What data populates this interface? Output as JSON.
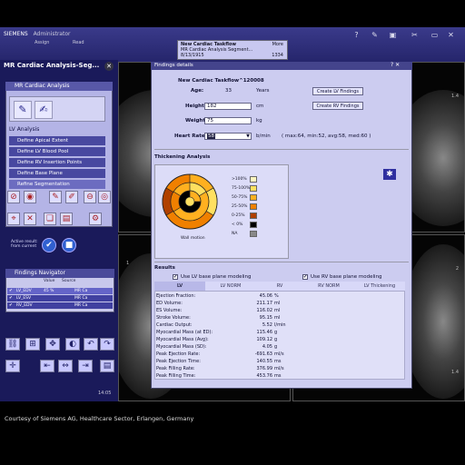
{
  "topbar": {
    "brand": "SIEMENS",
    "user": "Administrator",
    "nav": [
      "Assign",
      "Read"
    ],
    "taskflow": {
      "line1": "New Cardiac Taskflow",
      "line2": "MR Cardiac Analysis Segment...",
      "line3": "8/13/1915",
      "right1": "More",
      "right3": "1334"
    },
    "icons": [
      "help-icon",
      "edit-icon",
      "window-icon",
      "cancel-icon",
      "tools-icon",
      "folder-icon",
      "monitor-icon",
      "close-icon"
    ],
    "glyphs": [
      "?",
      "✎",
      "▣",
      "⊘",
      "✂",
      "▭",
      "▦",
      "✕"
    ]
  },
  "left": {
    "title": "MR Cardiac Analysis-Seg...",
    "sub_title": "MR Cardiac Analysis",
    "section": "LV Analysis",
    "steps": [
      "Define Apical Extent",
      "Define LV Blood Pool",
      "Define RV Insertion Points",
      "Define Base Plane",
      "Refine Segmentation"
    ],
    "active_result": "Active result: from current",
    "findings_title": "Findings Navigator",
    "findings_cols": [
      "Value",
      "Source"
    ],
    "findings": [
      {
        "name": "LV_EDV",
        "value": "45 %",
        "source": "MR Ca"
      },
      {
        "name": "LV_ESV",
        "value": "",
        "source": "MR Ca"
      },
      {
        "name": "RV_EDV",
        "value": "",
        "source": "MR Ca"
      }
    ],
    "time": "14:05"
  },
  "viewports": {
    "num_tr": "1.4",
    "num_ml": "1",
    "num_mr": "2",
    "num_br": "1.4"
  },
  "dialog": {
    "title": "Findings details",
    "controls": "? ✕",
    "taskflow": "New Cardiac Taskflow^120008",
    "age_label": "Age:",
    "age_value": "33",
    "age_unit": "Years",
    "height_label": "Height:",
    "height_value": "182",
    "height_unit": "cm",
    "weight_label": "Weight:",
    "weight_value": "75",
    "weight_unit": "kg",
    "hr_label": "Heart Rate:",
    "hr_value": "58",
    "hr_unit": "b/min",
    "hr_stats": "( max:64, min:52, avg:58, med:60 )",
    "btn_lv": "Create LV Findings",
    "btn_rv": "Create RV Findings",
    "thick_title": "Thickening Analysis",
    "wall_motion": "Wall motion",
    "legend": [
      {
        "label": ">100%",
        "color": "#fff7c0"
      },
      {
        "label": "75-100%",
        "color": "#ffe060"
      },
      {
        "label": "50-75%",
        "color": "#ffb020"
      },
      {
        "label": "25-50%",
        "color": "#f08000"
      },
      {
        "label": "0-25%",
        "color": "#b04000"
      },
      {
        "label": "< 0%",
        "color": "#000000"
      },
      {
        "label": "NA",
        "color": "#888888"
      }
    ],
    "results_title": "Results",
    "lv_check": "Use LV base plane modeling",
    "rv_check": "Use RV base plane modeling",
    "tabs": [
      "LV",
      "LV NORM",
      "RV",
      "RV NORM",
      "LV Thickening"
    ],
    "results": [
      {
        "name": "Ejection Fraction:",
        "value": "45.06",
        "unit": "%"
      },
      {
        "name": "ED Volume:",
        "value": "211.17",
        "unit": "ml"
      },
      {
        "name": "ES Volume:",
        "value": "116.02",
        "unit": "ml"
      },
      {
        "name": "Stroke Volume:",
        "value": "95.15",
        "unit": "ml"
      },
      {
        "name": "Cardiac Output:",
        "value": "5.52",
        "unit": "l/min"
      },
      {
        "name": "Myocardial Mass (at ED):",
        "value": "115.46",
        "unit": "g"
      },
      {
        "name": "Myocardial Mass (Avg):",
        "value": "109.12",
        "unit": "g"
      },
      {
        "name": "Myocardial Mass (SD):",
        "value": "4.05",
        "unit": "g"
      },
      {
        "name": "Peak Ejection Rate:",
        "value": "-691.63",
        "unit": "ml/s"
      },
      {
        "name": "Peak Ejection Time:",
        "value": "140.55",
        "unit": "ms"
      },
      {
        "name": "Peak Filling Rate:",
        "value": "376.99",
        "unit": "ml/s"
      },
      {
        "name": "Peak Filling Time:",
        "value": "453.76",
        "unit": "ms"
      }
    ]
  },
  "credit": "Courtesy of Siemens AG, Healthcare Sector, Erlangen, Germany"
}
